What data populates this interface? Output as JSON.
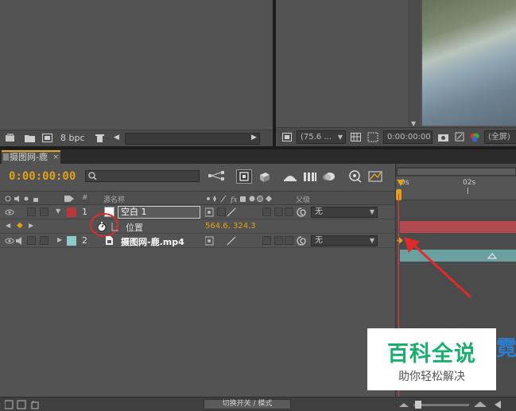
{
  "project_panel": {
    "footer": {
      "bpc_label": "8 bpc"
    }
  },
  "comp_viewer": {
    "zoom_value": "(75.6 ...",
    "timecode": "0:00:00:00",
    "resolution": "(全屏)"
  },
  "timeline": {
    "tab_label": "摄图网-鹿",
    "current_time": "0:00:00:00",
    "columns": {
      "source_name": "源名称",
      "parent": "父级"
    },
    "ruler": {
      "start_label": "0s",
      "mark_label": "02s"
    },
    "layers": [
      {
        "index": "1",
        "name": "空白 1",
        "parent": "无",
        "label_color": "#b9383c",
        "property": {
          "name": "位置",
          "value": "564.6, 324.3"
        }
      },
      {
        "index": "2",
        "name": "摄图网-鹿.mp4",
        "parent": "无",
        "label_color": "#8ecaca"
      }
    ],
    "footer": {
      "toggle_label": "切换开关 / 模式"
    }
  },
  "watermark": {
    "title": "百科全说",
    "subtitle": "助你轻松解决",
    "side_text": "霓"
  },
  "colors": {
    "accent": "#e0a21a",
    "playhead": "#e43a3a",
    "annotation": "#e02b2b"
  }
}
